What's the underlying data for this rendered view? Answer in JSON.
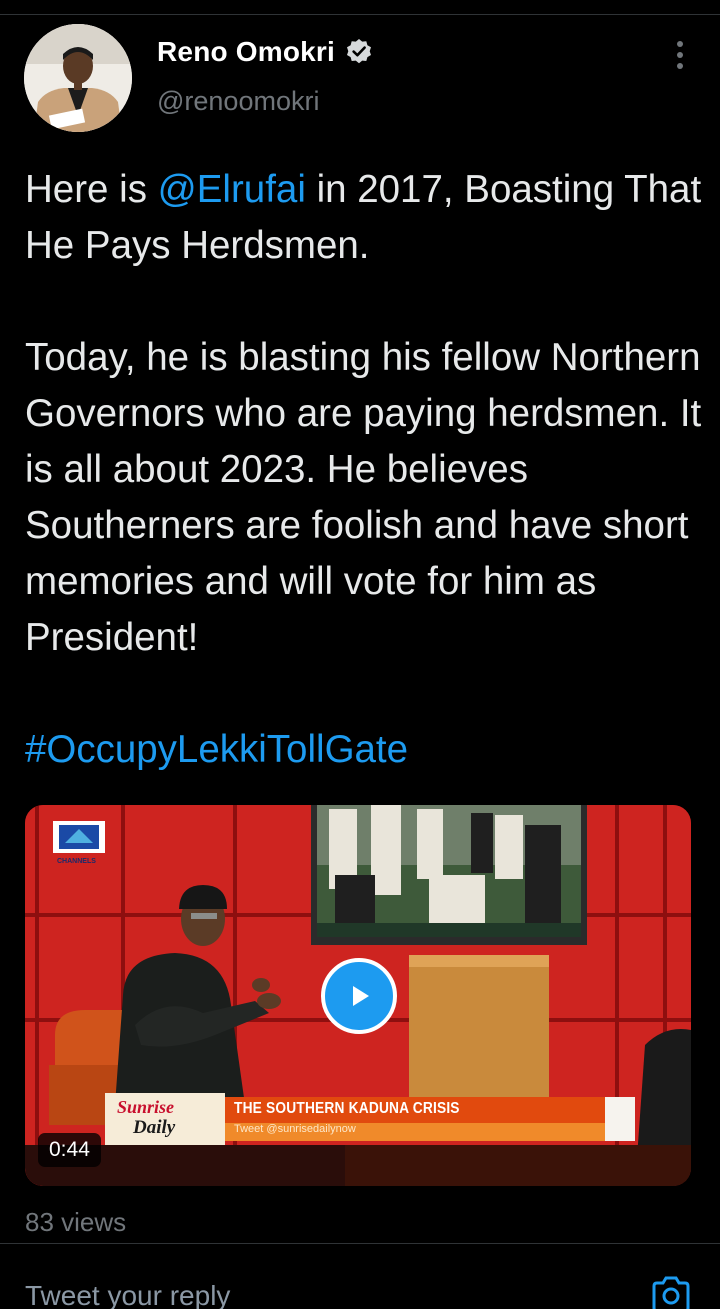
{
  "tweet": {
    "author": {
      "display_name": "Reno Omokri",
      "handle": "@renoomokri",
      "verified": true
    },
    "text": {
      "intro_before": "Here is ",
      "mention": "@Elrufai",
      "intro_after": " in 2017, Boasting That He Pays Herdsmen.",
      "body": "Today, he is blasting his fellow Northern Governors who are paying herdsmen. It is all about 2023. He believes Southerners are foolish and have short memories and will vote for him as President!",
      "hashtag": "#OccupyLekkiTollGate"
    },
    "media": {
      "type": "video",
      "duration": "0:44",
      "channel_label": "CHANNELS",
      "show_logo_line1": "Sunrise",
      "show_logo_line2": "Daily",
      "lower_third_title": "THE SOUTHERN KADUNA CRISIS",
      "lower_third_subtitle": "Tweet @sunrisedailynow"
    },
    "views": "83 views"
  },
  "reply": {
    "placeholder": "Tweet your reply"
  },
  "icons": {
    "verified": "verified-badge-icon",
    "more": "more-vertical-icon",
    "play": "play-icon",
    "camera": "camera-icon"
  },
  "colors": {
    "background": "#000000",
    "text": "#e7e9ea",
    "secondary_text": "#71767b",
    "link": "#1d9bf0",
    "divider": "#2f3336"
  }
}
